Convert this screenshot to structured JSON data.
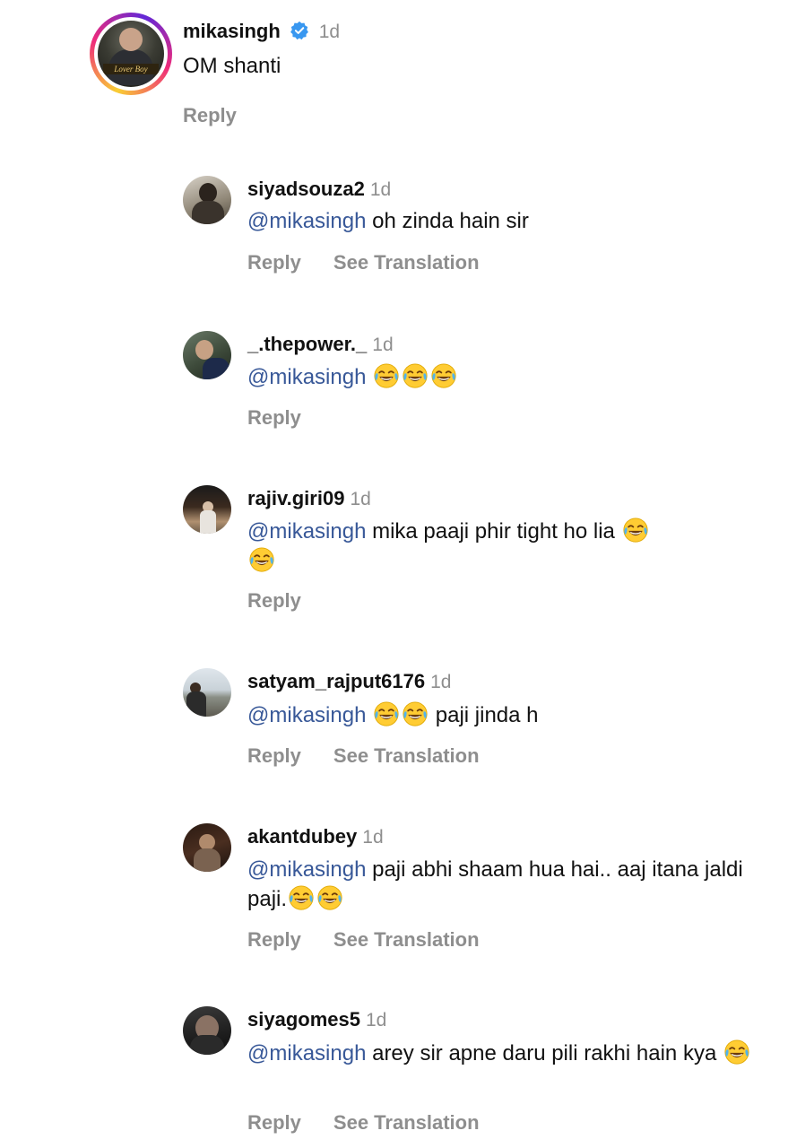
{
  "root": {
    "username": "mikasingh",
    "time": "1d",
    "text": "OM shanti",
    "reply_label": "Reply",
    "avatar_text": "Lover Boy"
  },
  "replies": [
    {
      "username": "siyadsouza2",
      "time": "1d",
      "mention": "@mikasingh",
      "text": "oh zinda hain sir",
      "reply_label": "Reply",
      "translate_label": "See Translation"
    },
    {
      "username": "_.thepower._",
      "time": "1d",
      "mention": "@mikasingh",
      "text": "",
      "reply_label": "Reply"
    },
    {
      "username": "rajiv.giri09",
      "time": "1d",
      "mention": "@mikasingh",
      "text": "mika paaji phir tight ho lia",
      "reply_label": "Reply"
    },
    {
      "username": "satyam_rajput6176",
      "time": "1d",
      "mention": "@mikasingh",
      "text": "paji jinda h",
      "reply_label": "Reply",
      "translate_label": "See Translation"
    },
    {
      "username": "akantdubey",
      "time": "1d",
      "mention": "@mikasingh",
      "text": "paji abhi shaam hua hai.. aaj itana jaldi paji.",
      "reply_label": "Reply",
      "translate_label": "See Translation"
    },
    {
      "username": "siyagomes5",
      "time": "1d",
      "mention": "@mikasingh",
      "text": "arey sir apne daru pili rakhi hain kya",
      "reply_label": "Reply",
      "translate_label": "See Translation"
    }
  ],
  "colors": {
    "mention": "#385898",
    "muted": "#8e8e8e",
    "verified": "#3897f0"
  },
  "icons": {
    "verified": "verified-badge-icon",
    "emoji": "face-with-tears-of-joy-emoji"
  }
}
